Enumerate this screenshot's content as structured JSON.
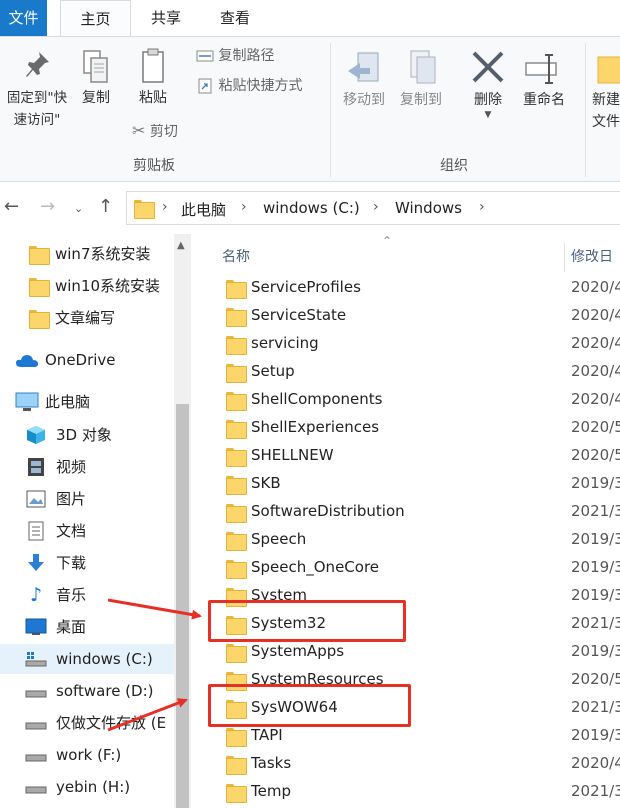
{
  "ribbon_tabs": {
    "file": "文件",
    "home": "主页",
    "share": "共享",
    "view": "查看"
  },
  "ribbon": {
    "pin_line1": "固定到\"快",
    "pin_line2": "速访问\"",
    "copy": "复制",
    "paste": "粘贴",
    "copy_path": "复制路径",
    "paste_shortcut": "粘贴快捷方式",
    "cut": "剪切",
    "clipboard_group": "剪贴板",
    "move_to": "移动到",
    "copy_to": "复制到",
    "delete": "删除",
    "rename": "重命名",
    "organize_group": "组织",
    "new_line1": "新建",
    "new_line2": "文件"
  },
  "address": {
    "crumbs": [
      "此电脑",
      "windows (C:)",
      "Windows"
    ],
    "separator": "›"
  },
  "nav": {
    "items": [
      {
        "label": "win7系统安装",
        "icon": "folder-icon"
      },
      {
        "label": "win10系统安装",
        "icon": "folder-icon"
      },
      {
        "label": "文章编写",
        "icon": "folder-icon"
      },
      {
        "label": "OneDrive",
        "icon": "cloud-icon"
      },
      {
        "label": "此电脑",
        "icon": "computer-icon"
      },
      {
        "label": "3D 对象",
        "icon": "cube-icon"
      },
      {
        "label": "视频",
        "icon": "film-icon"
      },
      {
        "label": "图片",
        "icon": "picture-icon"
      },
      {
        "label": "文档",
        "icon": "document-icon"
      },
      {
        "label": "下载",
        "icon": "download-icon"
      },
      {
        "label": "音乐",
        "icon": "music-note-icon"
      },
      {
        "label": "桌面",
        "icon": "desktop-icon"
      },
      {
        "label": "windows (C:)",
        "icon": "system-drive-icon"
      },
      {
        "label": "software (D:)",
        "icon": "drive-icon"
      },
      {
        "label": "仅做文件存放 (E",
        "icon": "drive-icon"
      },
      {
        "label": "work (F:)",
        "icon": "drive-icon"
      },
      {
        "label": "yebin (H:)",
        "icon": "drive-icon"
      }
    ]
  },
  "list": {
    "col_name": "名称",
    "col_date": "修改日",
    "rows": [
      {
        "name": "ServiceProfiles",
        "date": "2020/4"
      },
      {
        "name": "ServiceState",
        "date": "2020/4"
      },
      {
        "name": "servicing",
        "date": "2020/4"
      },
      {
        "name": "Setup",
        "date": "2020/4"
      },
      {
        "name": "ShellComponents",
        "date": "2020/4"
      },
      {
        "name": "ShellExperiences",
        "date": "2020/5"
      },
      {
        "name": "SHELLNEW",
        "date": "2020/5"
      },
      {
        "name": "SKB",
        "date": "2019/3"
      },
      {
        "name": "SoftwareDistribution",
        "date": "2021/3"
      },
      {
        "name": "Speech",
        "date": "2019/3"
      },
      {
        "name": "Speech_OneCore",
        "date": "2019/3"
      },
      {
        "name": "System",
        "date": "2019/3"
      },
      {
        "name": "System32",
        "date": "2021/3"
      },
      {
        "name": "SystemApps",
        "date": "2019/3"
      },
      {
        "name": "SystemResources",
        "date": "2020/5"
      },
      {
        "name": "SysWOW64",
        "date": "2021/3"
      },
      {
        "name": "TAPI",
        "date": "2019/3"
      },
      {
        "name": "Tasks",
        "date": "2020/4"
      },
      {
        "name": "Temp",
        "date": "2021/3"
      }
    ]
  },
  "colors": {
    "accent": "#1979ca",
    "folder": "#fcd56b",
    "annotation_red": "#e53027",
    "selected_nav": "#e5f1fb"
  }
}
